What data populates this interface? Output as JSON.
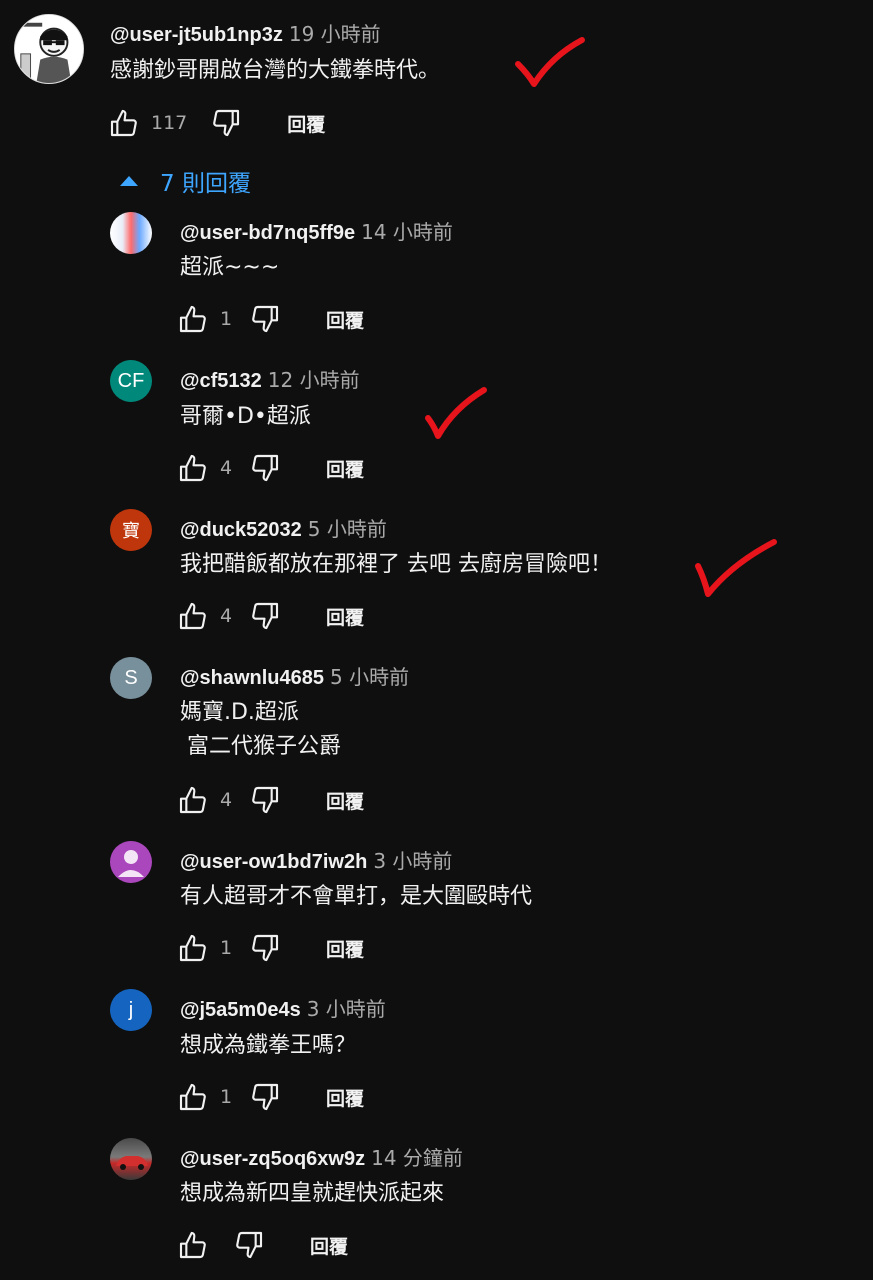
{
  "main_comment": {
    "handle": "@user-jt5ub1np3z",
    "time": "19 小時前",
    "text": "感謝鈔哥開啟台灣的大鐵拳時代。",
    "likes": "117",
    "reply_label": "回覆",
    "avatar_icon": "cartoon-avatar"
  },
  "replies_toggle": {
    "label": "7 則回覆",
    "icon": "caret-up-icon",
    "color": "#3ea6ff"
  },
  "replies": [
    {
      "handle": "@user-bd7nq5ff9e",
      "time": "14 小時前",
      "text": "超派~~~",
      "likes": "1",
      "reply_label": "回覆",
      "avatar_letter": "",
      "avatar_color": "#dfe9f5"
    },
    {
      "handle": "@cf5132",
      "time": "12 小時前",
      "text": "哥爾•D•超派",
      "likes": "4",
      "reply_label": "回覆",
      "avatar_letter": "CF",
      "avatar_color": "#00897b"
    },
    {
      "handle": "@duck52032",
      "time": "5 小時前",
      "text": "我把醋飯都放在那裡了 去吧 去廚房冒險吧！",
      "likes": "4",
      "reply_label": "回覆",
      "avatar_letter": "寶",
      "avatar_color": "#bf360c"
    },
    {
      "handle": "@shawnlu4685",
      "time": "5 小時前",
      "text": "媽寶.D.超派\n 富二代猴子公爵",
      "likes": "4",
      "reply_label": "回覆",
      "avatar_letter": "S",
      "avatar_color": "#78909c"
    },
    {
      "handle": "@user-ow1bd7iw2h",
      "time": "3 小時前",
      "text": "有人超哥才不會單打，是大圍毆時代",
      "likes": "1",
      "reply_label": "回覆",
      "avatar_letter": "",
      "avatar_color": "#ab47bc"
    },
    {
      "handle": "@j5a5m0e4s",
      "time": "3 小時前",
      "text": "想成為鐵拳王嗎？",
      "likes": "1",
      "reply_label": "回覆",
      "avatar_letter": "j",
      "avatar_color": "#1565c0"
    },
    {
      "handle": "@user-zq5oq6xw9z",
      "time": "14 分鐘前",
      "text": "想成為新四皇就趕快派起來",
      "likes": "",
      "reply_label": "回覆",
      "avatar_letter": "",
      "avatar_color": "#6d6d6d"
    }
  ],
  "annotations": {
    "checkmark_color": "#e8141c"
  }
}
